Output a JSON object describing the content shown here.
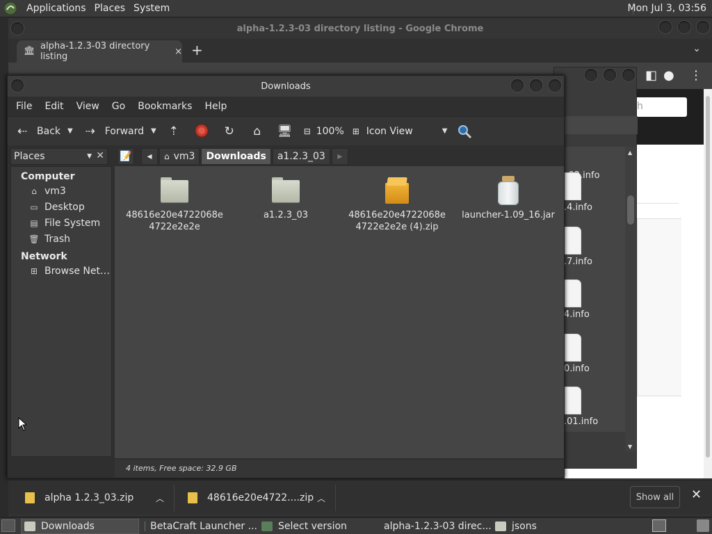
{
  "top_panel": {
    "menus": [
      "Applications",
      "Places",
      "System"
    ],
    "clock": "Mon Jul  3, 03:56"
  },
  "chrome": {
    "window_title": "alpha-1.2.3-03 directory listing - Google Chrome",
    "tab_title": "alpha-1.2.3-03 directory listing",
    "tab_close": "×",
    "new_tab": "+",
    "search_partial": "h",
    "listing_files": [
      "_02.info",
      ".4.info",
      ".7.info",
      "4.info",
      "0.info",
      ".01.info"
    ]
  },
  "file_manager": {
    "title": "Downloads",
    "menu": [
      "File",
      "Edit",
      "View",
      "Go",
      "Bookmarks",
      "Help"
    ],
    "toolbar": {
      "back": "Back",
      "forward": "Forward",
      "zoom": "100%",
      "view_mode": "Icon View"
    },
    "places_label": "Places",
    "breadcrumbs": [
      "vm3",
      "Downloads",
      "a1.2.3_03"
    ],
    "sidebar": {
      "computer_header": "Computer",
      "computer_items": [
        "vm3",
        "Desktop",
        "File System",
        "Trash"
      ],
      "network_header": "Network",
      "network_items": [
        "Browse Net…"
      ]
    },
    "files": [
      {
        "name": "48616e20e4722068e4722e2e2e",
        "kind": "folder"
      },
      {
        "name": "a1.2.3_03",
        "kind": "folder"
      },
      {
        "name": "48616e20e4722068e4722e2e2e (4).zip",
        "kind": "zip"
      },
      {
        "name": "launcher-1.09_16.jar",
        "kind": "jar"
      }
    ],
    "status": "4 items, Free space: 32.9 GB"
  },
  "downloads_shelf": {
    "items": [
      "alpha 1.2.3_03.zip",
      "48616e20e4722....zip"
    ],
    "show_all": "Show all",
    "close": "✕"
  },
  "taskbar": {
    "tasks": [
      "Downloads",
      "BetaCraft Launcher ...",
      "Select version",
      "alpha-1.2.3-03 direc...",
      "jsons"
    ]
  }
}
